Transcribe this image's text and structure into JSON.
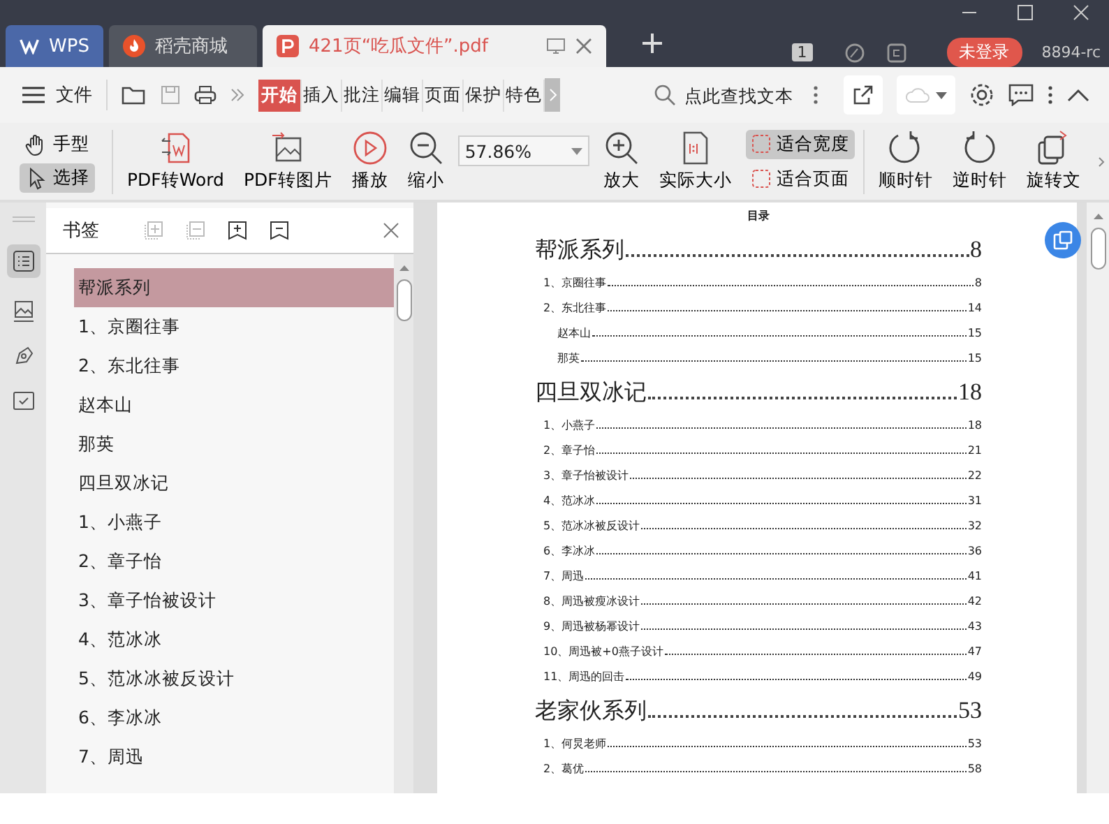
{
  "tabs": [
    {
      "label": "WPS",
      "kind": "home",
      "selected": false
    },
    {
      "label": "稻壳商城",
      "kind": "store",
      "selected": false
    },
    {
      "label": "421页“吃瓜文件”.pdf",
      "kind": "pdf",
      "selected": true
    }
  ],
  "title_bar": {
    "page_count": "1",
    "login_button": "未登录",
    "user": "8894-rc"
  },
  "menu": {
    "file": "文件",
    "tabs": [
      {
        "label": "开始",
        "selected": true
      },
      {
        "label": "插入",
        "selected": false
      },
      {
        "label": "批注",
        "selected": false
      },
      {
        "label": "编辑",
        "selected": false
      },
      {
        "label": "页面",
        "selected": false
      },
      {
        "label": "保护",
        "selected": false
      },
      {
        "label": "特色",
        "selected": false
      }
    ],
    "search_placeholder": "点此查找文本"
  },
  "toolbar": {
    "tools": [
      {
        "kind": "hand",
        "label": "手型",
        "selected": false
      },
      {
        "kind": "select",
        "label": "选择",
        "selected": true
      }
    ],
    "actions": [
      {
        "kind": "word",
        "label": "PDF转Word"
      },
      {
        "kind": "image",
        "label": "PDF转图片"
      },
      {
        "kind": "play",
        "label": "播放"
      },
      {
        "kind": "zoomout",
        "label": "缩小"
      }
    ],
    "zoom": "57.86%",
    "actions2": [
      {
        "kind": "zoomin",
        "label": "放大"
      },
      {
        "kind": "actual",
        "label": "实际大小"
      }
    ],
    "fit": [
      {
        "label": "适合宽度",
        "selected": true
      },
      {
        "label": "适合页面",
        "selected": false
      }
    ],
    "actions3": [
      {
        "kind": "cw",
        "label": "顺时针"
      },
      {
        "kind": "ccw",
        "label": "逆时针"
      },
      {
        "kind": "rotate",
        "label": "旋转文"
      }
    ]
  },
  "sidebar": {
    "title": "书签",
    "bookmarks": [
      {
        "label": "帮派系列",
        "selected": true
      },
      {
        "label": "1、京圈往事",
        "selected": false
      },
      {
        "label": "2、东北往事",
        "selected": false
      },
      {
        "label": "赵本山",
        "selected": false
      },
      {
        "label": "那英",
        "selected": false
      },
      {
        "label": "四旦双冰记",
        "selected": false
      },
      {
        "label": "1、小燕子",
        "selected": false
      },
      {
        "label": "2、章子怡",
        "selected": false
      },
      {
        "label": "3、章子怡被设计",
        "selected": false
      },
      {
        "label": "4、范冰冰",
        "selected": false
      },
      {
        "label": "5、范冰冰被反设计",
        "selected": false
      },
      {
        "label": "6、李冰冰",
        "selected": false
      },
      {
        "label": "7、周迅",
        "selected": false
      }
    ]
  },
  "document": {
    "heading": "目录",
    "entries": [
      {
        "kind": "h1",
        "title": "帮派系列",
        "page": "8"
      },
      {
        "kind": "h2",
        "title": "1、京圈往事",
        "page": "8"
      },
      {
        "kind": "h2",
        "title": "2、东北往事",
        "page": "14"
      },
      {
        "kind": "h3",
        "title": "赵本山",
        "page": "15"
      },
      {
        "kind": "h3",
        "title": "那英",
        "page": "15"
      },
      {
        "kind": "h1",
        "title": "四旦双冰记",
        "page": "18"
      },
      {
        "kind": "h2",
        "title": "1、小燕子",
        "page": "18"
      },
      {
        "kind": "h2",
        "title": "2、章子怡",
        "page": "21"
      },
      {
        "kind": "h2",
        "title": "3、章子怡被设计",
        "page": "22"
      },
      {
        "kind": "h2",
        "title": "4、范冰冰",
        "page": "31"
      },
      {
        "kind": "h2",
        "title": "5、范冰冰被反设计",
        "page": "32"
      },
      {
        "kind": "h2",
        "title": "6、李冰冰",
        "page": "36"
      },
      {
        "kind": "h2",
        "title": "7、周迅",
        "page": "41"
      },
      {
        "kind": "h2",
        "title": "8、周迅被瘦冰设计",
        "page": "42"
      },
      {
        "kind": "h2",
        "title": "9、周迅被杨幂设计",
        "page": "43"
      },
      {
        "kind": "h2",
        "title": "10、周迅被+0燕子设计",
        "page": "47"
      },
      {
        "kind": "h2",
        "title": "11、周迅的回击",
        "page": "49"
      },
      {
        "kind": "h1",
        "title": "老家伙系列",
        "page": "53"
      },
      {
        "kind": "h2",
        "title": "1、何炅老师",
        "page": "53"
      },
      {
        "kind": "h2",
        "title": "2、葛优",
        "page": "58"
      }
    ]
  }
}
